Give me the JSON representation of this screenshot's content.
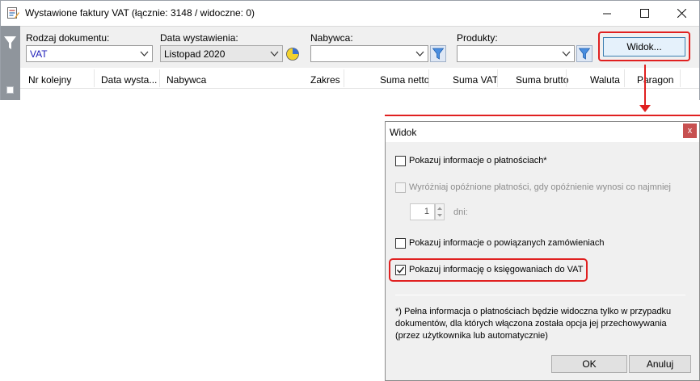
{
  "window": {
    "title": "Wystawione faktury VAT (łącznie: 3148 / widoczne: 0)",
    "controls": [
      "minimize",
      "maximize",
      "close"
    ]
  },
  "filters": {
    "doc_type": {
      "label": "Rodzaj dokumentu:",
      "value": "VAT"
    },
    "issue_date": {
      "label": "Data wystawienia:",
      "value": "Listopad 2020"
    },
    "buyer": {
      "label": "Nabywca:",
      "value": ""
    },
    "products": {
      "label": "Produkty:",
      "value": ""
    },
    "view_button": "Widok..."
  },
  "table": {
    "columns": [
      "Nr kolejny",
      "Data wysta...",
      "Nabywca",
      "Zakres",
      "Suma netto",
      "Suma VAT",
      "Suma brutto",
      "Waluta",
      "Paragon"
    ]
  },
  "dialog": {
    "title": "Widok",
    "close": "x",
    "options": [
      {
        "label": "Pokazuj informacje o płatnościach*",
        "checked": false,
        "enabled": true
      },
      {
        "label": "Wyróżniaj opóźnione płatności, gdy opóźnienie wynosi co najmniej",
        "checked": false,
        "enabled": false
      },
      {
        "label": "Pokazuj informacje o powiązanych zamówieniach",
        "checked": false,
        "enabled": true
      },
      {
        "label": "Pokazuj informację o księgowaniach do VAT",
        "checked": true,
        "enabled": true
      }
    ],
    "days": {
      "value": "1",
      "unit": "dni:"
    },
    "note": "*) Pełna informacja o płatnościach będzie widoczna tylko w przypadku dokumentów, dla których włączona została opcja jej przechowywania (przez użytkownika lub automatycznie)",
    "ok": "OK",
    "cancel": "Anuluj"
  },
  "colors": {
    "highlight": "#e02020",
    "accent": "#3c7fb1",
    "dialog_bg": "#f0f0f0"
  }
}
